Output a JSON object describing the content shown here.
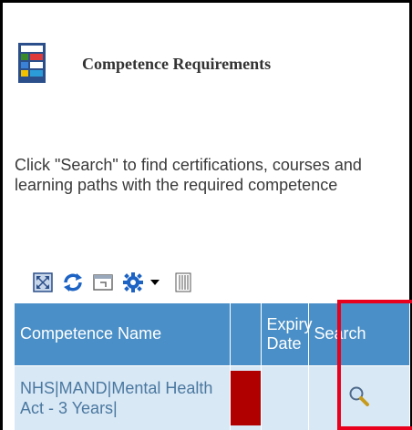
{
  "header": {
    "title": "Competence Requirements",
    "icon": "report-list-icon"
  },
  "instructions": "Click \"Search\" to find certifications, courses and learning paths with the required competence",
  "toolbar": {
    "buttons": [
      {
        "name": "maximize-icon"
      },
      {
        "name": "refresh-icon"
      },
      {
        "name": "restore-icon"
      },
      {
        "name": "gear-icon"
      },
      {
        "name": "dropdown-caret-icon"
      },
      {
        "name": "columns-icon"
      }
    ]
  },
  "grid": {
    "columns": [
      "Competence Name",
      "",
      "Expiry Date",
      "Search"
    ],
    "rows": [
      {
        "competence_name": "NHS|MAND|Mental Health Act - 3 Years|",
        "status_color": "#b00000",
        "expiry_date": "",
        "search_icon": "magnifier-icon"
      }
    ]
  },
  "colors": {
    "header_bg": "#4a8fc7",
    "row_bg": "#d9e8f5",
    "highlight": "#e8001c"
  }
}
